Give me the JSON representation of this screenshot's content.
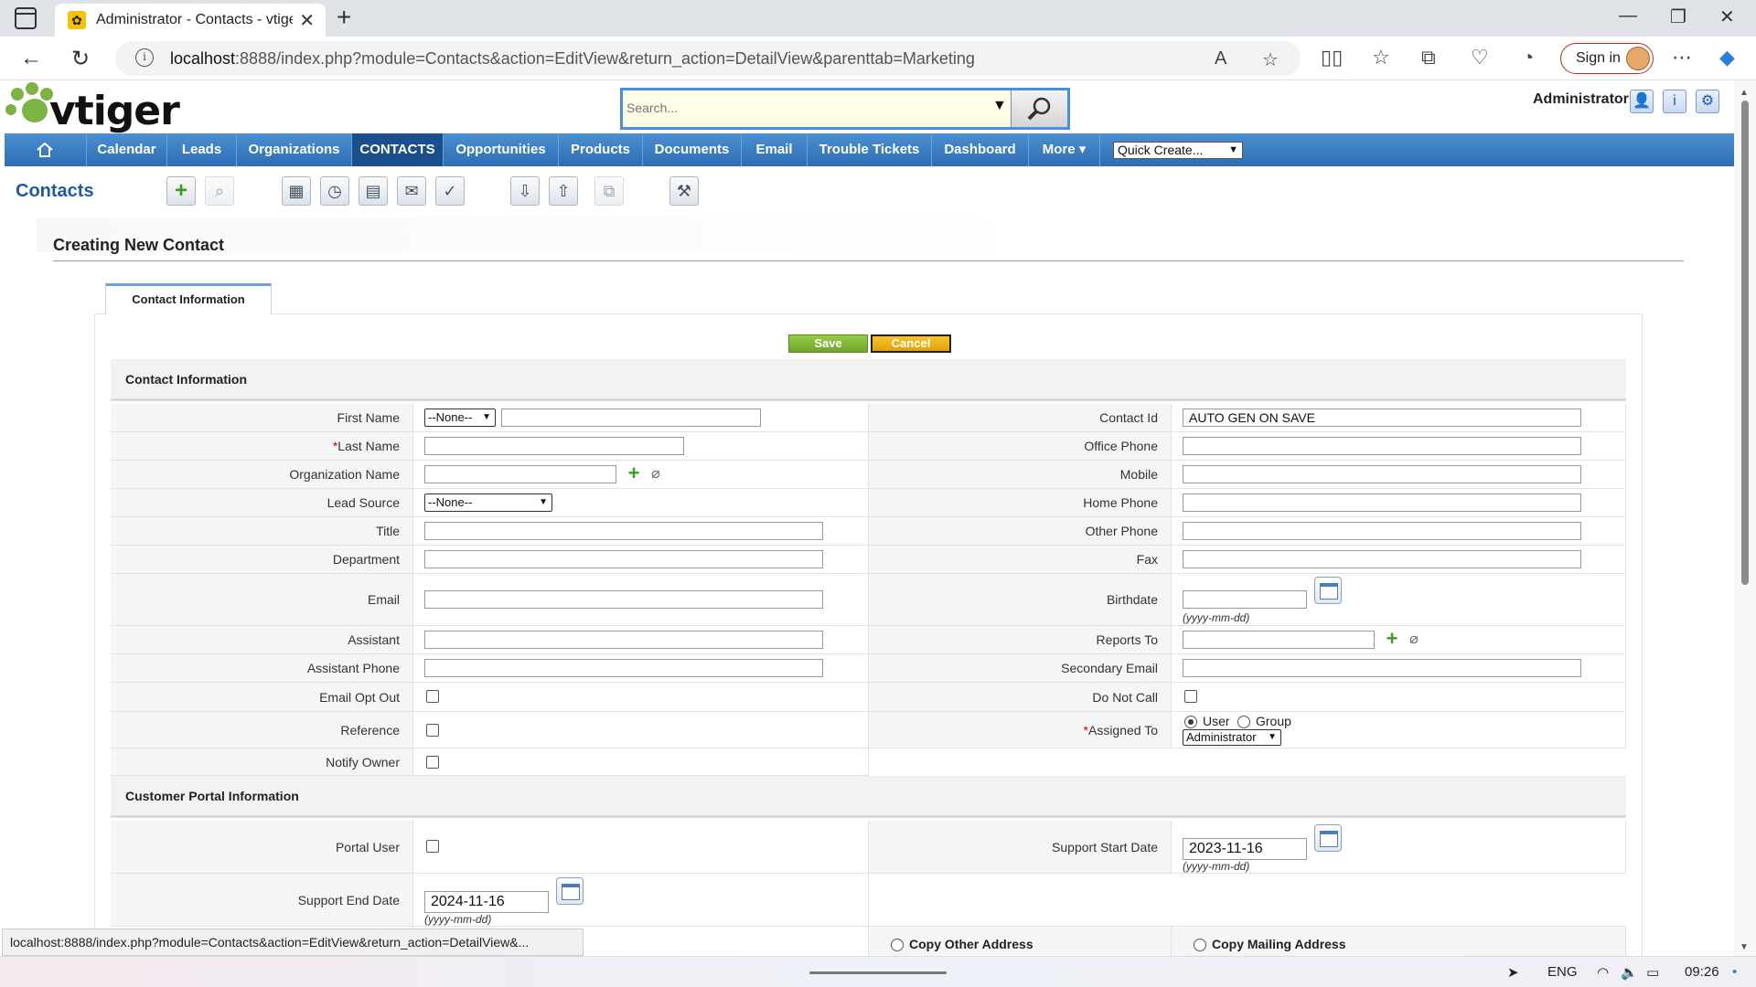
{
  "browser": {
    "tab_title": "Administrator - Contacts - vtiger",
    "tab_close": "✕",
    "new_tab": "+",
    "url_host": "localhost",
    "url_rest": ":8888/index.php?module=Contacts&action=EditView&return_action=DetailView&parenttab=Marketing",
    "signin_label": "Sign in",
    "status_url": "localhost:8888/index.php?module=Contacts&action=EditView&return_action=DetailView&..."
  },
  "header": {
    "logo_text": "vtiger",
    "search_placeholder": "Search...",
    "admin_name": "Administrator"
  },
  "menu": {
    "items": [
      "Calendar",
      "Leads",
      "Organizations",
      "CONTACTS",
      "Opportunities",
      "Products",
      "Documents",
      "Email",
      "Trouble Tickets",
      "Dashboard",
      "More ▾"
    ],
    "active": "CONTACTS",
    "quick_create": "Quick Create..."
  },
  "module": {
    "title": "Contacts",
    "edit_title": "Creating New Contact",
    "tab_label": "Contact Information",
    "save_label": "Save",
    "cancel_label": "Cancel"
  },
  "sections": {
    "contact_info": "Contact Information",
    "portal_info": "Customer Portal Information"
  },
  "fields": {
    "first_name": "First Name",
    "salutation": "--None--",
    "last_name": "Last Name",
    "required_mark": "*",
    "org_name": "Organization Name",
    "lead_source": "Lead Source",
    "lead_source_value": "--None--",
    "title": "Title",
    "department": "Department",
    "email": "Email",
    "assistant": "Assistant",
    "assistant_phone": "Assistant Phone",
    "email_opt_out": "Email Opt Out",
    "reference": "Reference",
    "notify_owner": "Notify Owner",
    "contact_id": "Contact Id",
    "contact_id_value": "AUTO GEN ON SAVE",
    "office_phone": "Office Phone",
    "mobile": "Mobile",
    "home_phone": "Home Phone",
    "other_phone": "Other Phone",
    "fax": "Fax",
    "birthdate": "Birthdate",
    "date_hint": "(yyyy-mm-dd)",
    "reports_to": "Reports To",
    "secondary_email": "Secondary Email",
    "do_not_call": "Do Not Call",
    "assigned_to": "Assigned To",
    "assign_user": "User",
    "assign_group": "Group",
    "assigned_value": "Administrator",
    "portal_user": "Portal User",
    "support_start_date": "Support Start Date",
    "support_start_value": "2023-11-16",
    "support_end_date": "Support End Date",
    "support_end_value": "2024-11-16",
    "copy_other": "Copy Other Address",
    "copy_mailing": "Copy Mailing Address"
  },
  "taskbar": {
    "lang": "ENG",
    "time": "09:26"
  }
}
